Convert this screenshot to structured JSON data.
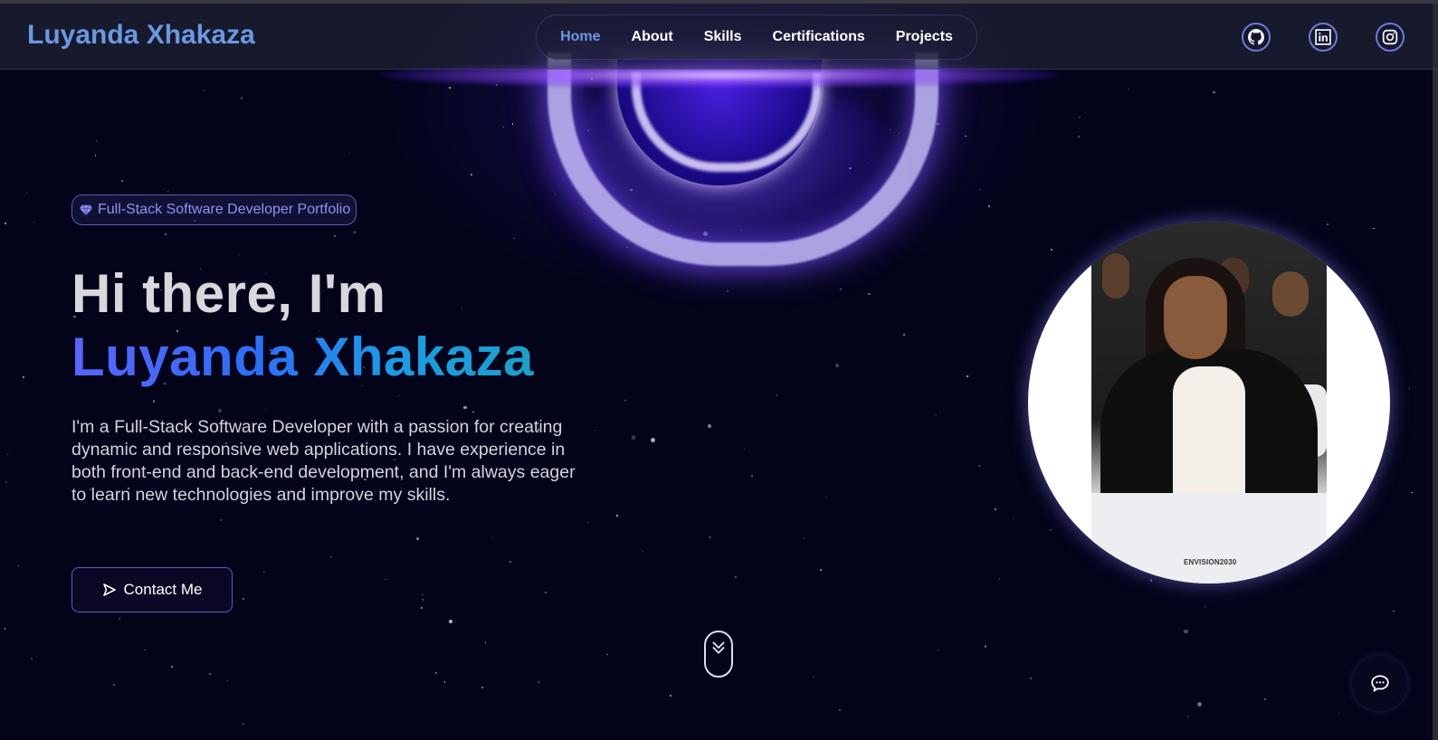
{
  "header": {
    "brand": "Luyanda Xhakaza",
    "nav": [
      {
        "label": "Home",
        "active": true
      },
      {
        "label": "About",
        "active": false
      },
      {
        "label": "Skills",
        "active": false
      },
      {
        "label": "Certifications",
        "active": false
      },
      {
        "label": "Projects",
        "active": false
      }
    ],
    "social_icons": [
      "github-icon",
      "linkedin-icon",
      "instagram-icon"
    ]
  },
  "hero": {
    "badge_icon": "gem-icon",
    "badge": "Full-Stack Software Developer Portfolio",
    "greeting": "Hi there, I'm",
    "name": "Luyanda Xhakaza",
    "intro": "I'm a Full-Stack Software Developer with a passion for creating dynamic and responsive web applications. I have experience in both front-end and back-end development, and I'm always eager to learn new technologies and improve my skills.",
    "cta_icon": "send-icon",
    "cta_label": "Contact Me"
  },
  "portrait": {
    "photo_caption": "ENVISION2030"
  },
  "scroll_icon": "double-chevron-down-icon",
  "chat_icon": "chat-bubble-icon",
  "colors": {
    "background": "#03041a",
    "accent": "#6b98e2",
    "badge_text": "#8f92f0",
    "name_gradient_start": "#5a63ff",
    "name_gradient_end": "#1aa0c8"
  }
}
